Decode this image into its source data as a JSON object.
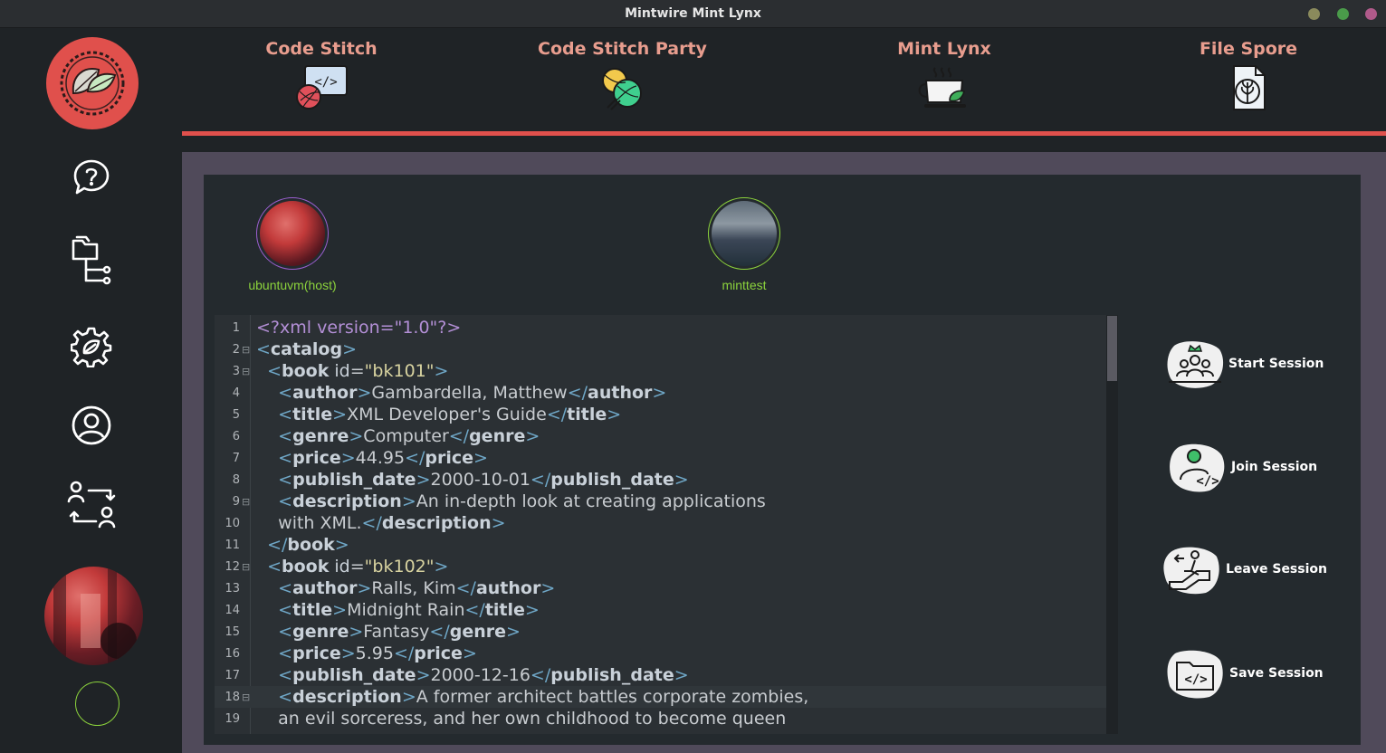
{
  "window": {
    "title": "Mintwire Mint Lynx",
    "buttons": [
      {
        "name": "minimize",
        "color": "#8a8a5c"
      },
      {
        "name": "maximize",
        "color": "#4a9a4a"
      },
      {
        "name": "close",
        "color": "#b05a8a"
      }
    ]
  },
  "colors": {
    "accent": "#e0504c",
    "nav_label": "#e89d8e",
    "online": "#8cd33c",
    "host_ring": "#9b5fd0"
  },
  "sidebar": {
    "logo_icon": "leaf-wreath-logo",
    "items": [
      {
        "icon": "help-chat-icon"
      },
      {
        "icon": "file-tree-icon"
      },
      {
        "icon": "settings-leaf-icon"
      },
      {
        "icon": "user-profile-icon"
      },
      {
        "icon": "switch-users-icon"
      }
    ]
  },
  "nav": {
    "items": [
      {
        "label": "Code Stitch",
        "icon": "yarn-code-icon"
      },
      {
        "label": "Code Stitch Party",
        "icon": "yarn-balls-icon"
      },
      {
        "label": "Mint Lynx",
        "icon": "mint-tea-cup-icon"
      },
      {
        "label": "File Spore",
        "icon": "file-leaf-icon"
      }
    ]
  },
  "session": {
    "users": [
      {
        "name": "ubuntuvm(host)"
      },
      {
        "name": "minttest"
      }
    ],
    "buttons": [
      {
        "label": "Start Session",
        "icon": "start-session-icon"
      },
      {
        "label": "Join Session",
        "icon": "join-session-icon"
      },
      {
        "label": "Leave Session",
        "icon": "leave-session-icon"
      },
      {
        "label": "Save Session",
        "icon": "save-session-icon"
      }
    ]
  },
  "editor": {
    "current_line": 18,
    "lines": [
      {
        "n": "1",
        "fold": "",
        "html": "<span class='pi'>&lt;?xml version=\"1.0\"?&gt;</span>"
      },
      {
        "n": "2",
        "fold": "⊟",
        "html": "<span class='tg'>&lt;</span><span class='tb'>catalog</span><span class='tg'>&gt;</span>"
      },
      {
        "n": "3",
        "fold": "⊟",
        "html": "  <span class='tg'>&lt;</span><span class='tb'>book</span> <span class='at'>id</span>=<span class='av'>\"bk101\"</span><span class='tg'>&gt;</span>"
      },
      {
        "n": "4",
        "fold": "",
        "html": "    <span class='tg'>&lt;</span><span class='tb'>author</span><span class='tg'>&gt;</span>Gambardella, Matthew<span class='tg'>&lt;/</span><span class='tb'>author</span><span class='tg'>&gt;</span>"
      },
      {
        "n": "5",
        "fold": "",
        "html": "    <span class='tg'>&lt;</span><span class='tb'>title</span><span class='tg'>&gt;</span>XML Developer's Guide<span class='tg'>&lt;/</span><span class='tb'>title</span><span class='tg'>&gt;</span>"
      },
      {
        "n": "6",
        "fold": "",
        "html": "    <span class='tg'>&lt;</span><span class='tb'>genre</span><span class='tg'>&gt;</span>Computer<span class='tg'>&lt;/</span><span class='tb'>genre</span><span class='tg'>&gt;</span>"
      },
      {
        "n": "7",
        "fold": "",
        "html": "    <span class='tg'>&lt;</span><span class='tb'>price</span><span class='tg'>&gt;</span>44.95<span class='tg'>&lt;/</span><span class='tb'>price</span><span class='tg'>&gt;</span>"
      },
      {
        "n": "8",
        "fold": "",
        "html": "    <span class='tg'>&lt;</span><span class='tb'>publish_date</span><span class='tg'>&gt;</span>2000-10-01<span class='tg'>&lt;/</span><span class='tb'>publish_date</span><span class='tg'>&gt;</span>"
      },
      {
        "n": "9",
        "fold": "⊟",
        "html": "    <span class='tg'>&lt;</span><span class='tb'>description</span><span class='tg'>&gt;</span>An in-depth look at creating applications"
      },
      {
        "n": "10",
        "fold": "",
        "html": "    with XML.<span class='tg'>&lt;/</span><span class='tb'>description</span><span class='tg'>&gt;</span>"
      },
      {
        "n": "11",
        "fold": "",
        "html": "  <span class='tg'>&lt;/</span><span class='tb'>book</span><span class='tg'>&gt;</span>"
      },
      {
        "n": "12",
        "fold": "⊟",
        "html": "  <span class='tg'>&lt;</span><span class='tb'>book</span> <span class='at'>id</span>=<span class='av'>\"bk102\"</span><span class='tg'>&gt;</span>"
      },
      {
        "n": "13",
        "fold": "",
        "html": "    <span class='tg'>&lt;</span><span class='tb'>author</span><span class='tg'>&gt;</span>Ralls, Kim<span class='tg'>&lt;/</span><span class='tb'>author</span><span class='tg'>&gt;</span>"
      },
      {
        "n": "14",
        "fold": "",
        "html": "    <span class='tg'>&lt;</span><span class='tb'>title</span><span class='tg'>&gt;</span>Midnight Rain<span class='tg'>&lt;/</span><span class='tb'>title</span><span class='tg'>&gt;</span>"
      },
      {
        "n": "15",
        "fold": "",
        "html": "    <span class='tg'>&lt;</span><span class='tb'>genre</span><span class='tg'>&gt;</span>Fantasy<span class='tg'>&lt;/</span><span class='tb'>genre</span><span class='tg'>&gt;</span>"
      },
      {
        "n": "16",
        "fold": "",
        "html": "    <span class='tg'>&lt;</span><span class='tb'>price</span><span class='tg'>&gt;</span>5.95<span class='tg'>&lt;/</span><span class='tb'>price</span><span class='tg'>&gt;</span>"
      },
      {
        "n": "17",
        "fold": "",
        "html": "    <span class='tg'>&lt;</span><span class='tb'>publish_date</span><span class='tg'>&gt;</span>2000-12-16<span class='tg'>&lt;/</span><span class='tb'>publish_date</span><span class='tg'>&gt;</span>"
      },
      {
        "n": "18",
        "fold": "⊟",
        "html": "    <span class='tg'>&lt;</span><span class='tb'>description</span><span class='tg'>&gt;</span>A former architect battles corporate zombies,"
      },
      {
        "n": "19",
        "fold": "",
        "html": "    an evil sorceress, and her own childhood to become queen"
      }
    ]
  }
}
